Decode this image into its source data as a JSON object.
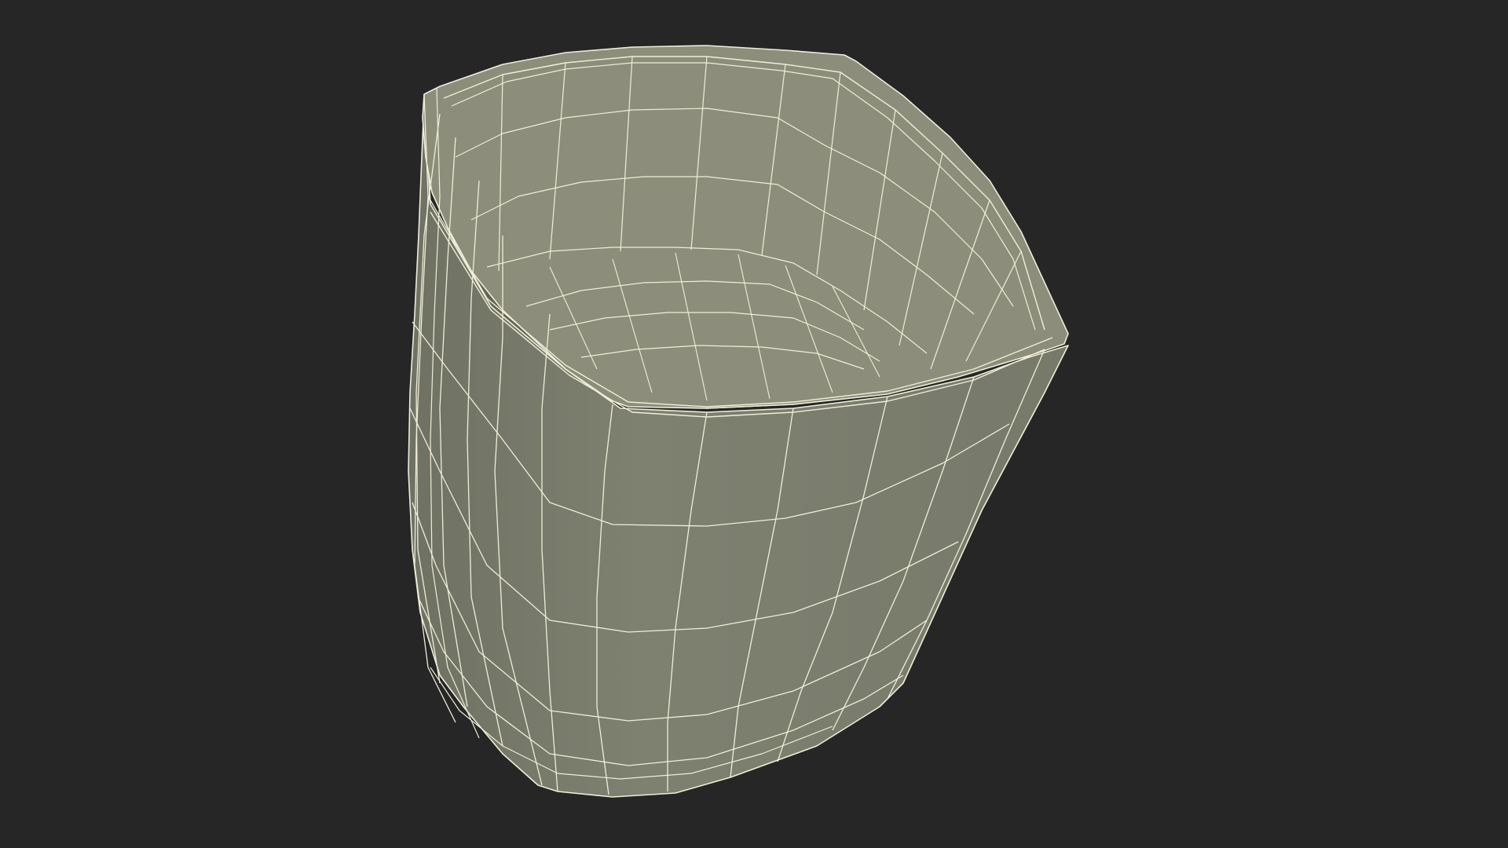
{
  "scene": {
    "subject": "wireframe-mesh-chair",
    "colors": {
      "background": "#262626",
      "outer_surface": "#7b7d6c",
      "inner_surface": "#5f604f",
      "seat_surface": "#6b6c5a",
      "rim_surface": "#8c8d7b",
      "wire": "#efeed8"
    }
  }
}
